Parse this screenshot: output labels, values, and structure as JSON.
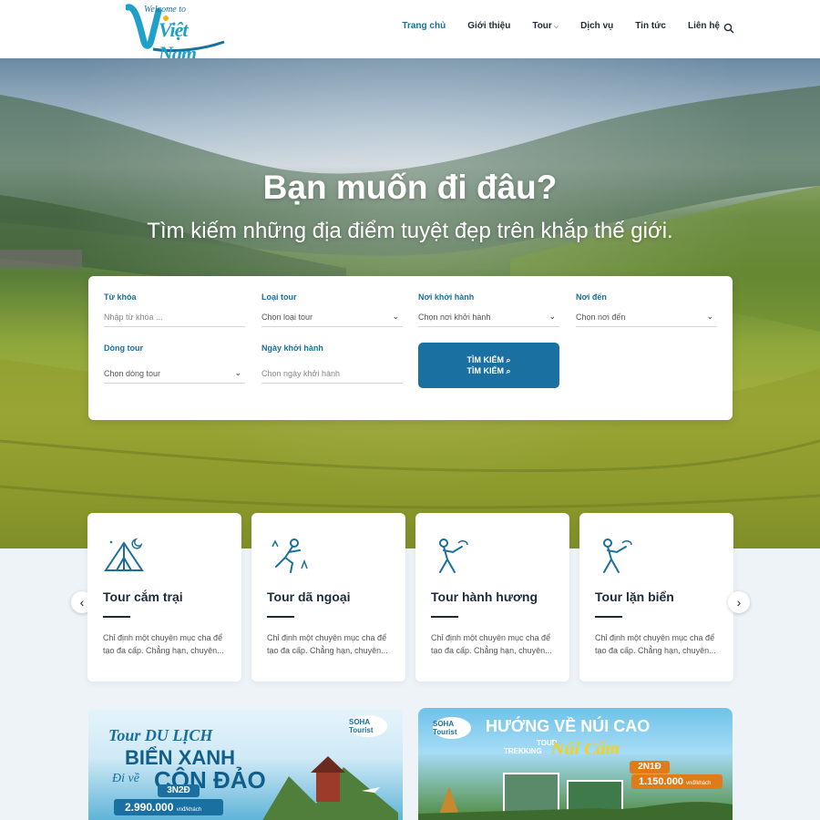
{
  "header": {
    "logo_top": "Welcome to",
    "logo_main": "Việt Nam",
    "nav": [
      {
        "label": "Trang chủ",
        "active": true
      },
      {
        "label": "Giới thiệu"
      },
      {
        "label": "Tour",
        "has_dropdown": true
      },
      {
        "label": "Dịch vụ"
      },
      {
        "label": "Tin tức"
      },
      {
        "label": "Liên hệ"
      }
    ]
  },
  "hero": {
    "title": "Bạn muốn đi đâu?",
    "subtitle": "Tìm kiếm những địa điểm tuyệt đẹp trên khắp thế giới."
  },
  "search": {
    "keyword": {
      "label": "Từ khóa",
      "placeholder": "Nhập từ khóa ..."
    },
    "tour_type": {
      "label": "Loại tour",
      "value": "Chọn loại tour"
    },
    "departure": {
      "label": "Nơi khởi hành",
      "value": "Chọn nơi khởi hành"
    },
    "destination": {
      "label": "Nơi đến",
      "value": "Chọn nơi đến"
    },
    "tour_line": {
      "label": "Dòng tour",
      "value": "Chọn dòng tour"
    },
    "start_date": {
      "label": "Ngày khởi hành",
      "placeholder": "Chọn ngày khởi hành"
    },
    "submit_label": "TÌM KIẾM"
  },
  "categories": [
    {
      "title": "Tour cắm trại",
      "icon": "tent-icon",
      "desc": "Chỉ định một chuyên mục cha để tạo đa cấp. Chẳng hạn, chuyên..."
    },
    {
      "title": "Tour dã ngoại",
      "icon": "climber-icon",
      "desc": "Chỉ định một chuyên mục cha để tạo đa cấp. Chẳng hạn, chuyên..."
    },
    {
      "title": "Tour hành hương",
      "icon": "hiker-icon",
      "desc": "Chỉ định một chuyên mục cha để tạo đa cấp. Chẳng hạn, chuyên..."
    },
    {
      "title": "Tour lặn biển",
      "icon": "hiker-icon",
      "desc": "Chỉ định một chuyên mục cha để tạo đa cấp. Chẳng hạn, chuyên..."
    }
  ],
  "banners": [
    {
      "brand": "SOHA Tourist",
      "line1": "Tour DU LỊCH",
      "line2": "BIỂN XANH",
      "line3": "Đi về",
      "line4": "CÔN ĐẢO",
      "duration": "3N2Đ",
      "price": "2.990.000",
      "price_unit": "vnđ/khách"
    },
    {
      "brand": "SOHA Tourist",
      "headline": "HƯỚNG VỀ NÚI CAO",
      "sub1": "TOUR",
      "sub2": "TREKKING",
      "place": "Núi Cấm",
      "duration": "2N1Đ",
      "price": "1.150.000",
      "price_unit": "vnđ/khách"
    }
  ],
  "colors": {
    "primary": "#1a70a0",
    "heading": "#1e2b38",
    "accent": "#1fa0c8"
  }
}
